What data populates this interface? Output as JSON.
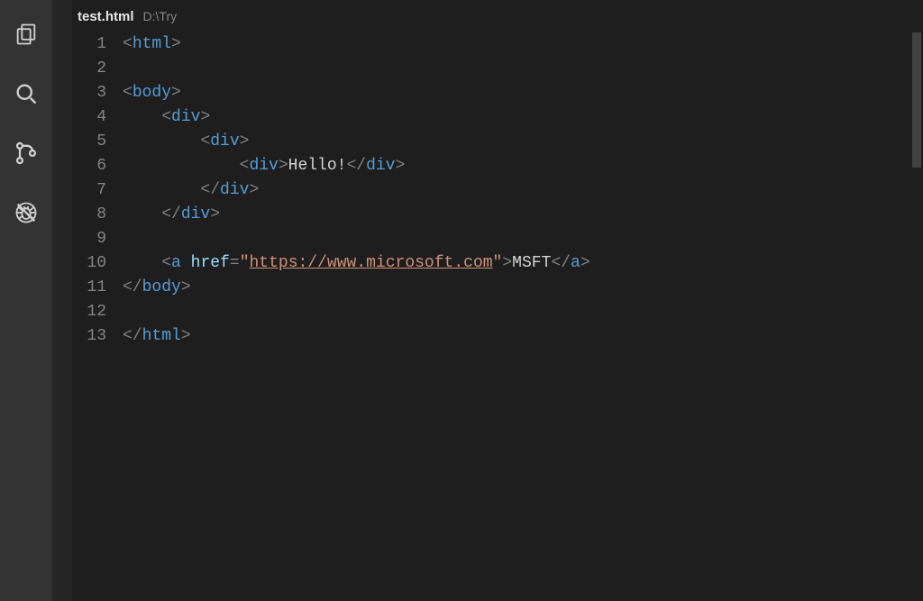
{
  "activity": {
    "items": [
      {
        "name": "explorer-icon"
      },
      {
        "name": "search-icon"
      },
      {
        "name": "source-control-icon"
      },
      {
        "name": "debug-icon"
      }
    ]
  },
  "tab": {
    "filename": "test.html",
    "path": "D:\\Try"
  },
  "lines": {
    "1": {
      "indent": 0,
      "segs": [
        [
          "p",
          "<"
        ],
        [
          "t",
          "html"
        ],
        [
          "p",
          ">"
        ]
      ]
    },
    "2": {
      "indent": 0,
      "segs": []
    },
    "3": {
      "indent": 0,
      "segs": [
        [
          "p",
          "<"
        ],
        [
          "t",
          "body"
        ],
        [
          "p",
          ">"
        ]
      ]
    },
    "4": {
      "indent": 1,
      "segs": [
        [
          "p",
          "<"
        ],
        [
          "t",
          "div"
        ],
        [
          "p",
          ">"
        ]
      ]
    },
    "5": {
      "indent": 2,
      "segs": [
        [
          "p",
          "<"
        ],
        [
          "t",
          "div"
        ],
        [
          "p",
          ">"
        ]
      ]
    },
    "6": {
      "indent": 3,
      "segs": [
        [
          "p",
          "<"
        ],
        [
          "t",
          "div"
        ],
        [
          "p",
          ">"
        ],
        [
          "tx",
          "Hello!"
        ],
        [
          "p",
          "</"
        ],
        [
          "t",
          "div"
        ],
        [
          "p",
          ">"
        ]
      ]
    },
    "7": {
      "indent": 2,
      "segs": [
        [
          "p",
          "</"
        ],
        [
          "t",
          "div"
        ],
        [
          "p",
          ">"
        ]
      ]
    },
    "8": {
      "indent": 1,
      "segs": [
        [
          "p",
          "</"
        ],
        [
          "t",
          "div"
        ],
        [
          "p",
          ">"
        ]
      ]
    },
    "9": {
      "indent": 0,
      "segs": []
    },
    "10": {
      "indent": 1,
      "segs": [
        [
          "p",
          "<"
        ],
        [
          "t",
          "a"
        ],
        [
          "tx",
          " "
        ],
        [
          "an",
          "href"
        ],
        [
          "p",
          "="
        ],
        [
          "av",
          "\""
        ],
        [
          "url",
          "https://www.microsoft.com"
        ],
        [
          "av",
          "\""
        ],
        [
          "p",
          ">"
        ],
        [
          "tx",
          "MSFT"
        ],
        [
          "p",
          "</"
        ],
        [
          "t",
          "a"
        ],
        [
          "p",
          ">"
        ]
      ]
    },
    "11": {
      "indent": 0,
      "segs": [
        [
          "p",
          "</"
        ],
        [
          "t",
          "body"
        ],
        [
          "p",
          ">"
        ]
      ]
    },
    "12": {
      "indent": 0,
      "segs": []
    },
    "13": {
      "indent": 0,
      "segs": [
        [
          "p",
          "</"
        ],
        [
          "t",
          "html"
        ],
        [
          "p",
          ">"
        ]
      ]
    }
  },
  "lineCount": 13,
  "indentUnit": "    "
}
